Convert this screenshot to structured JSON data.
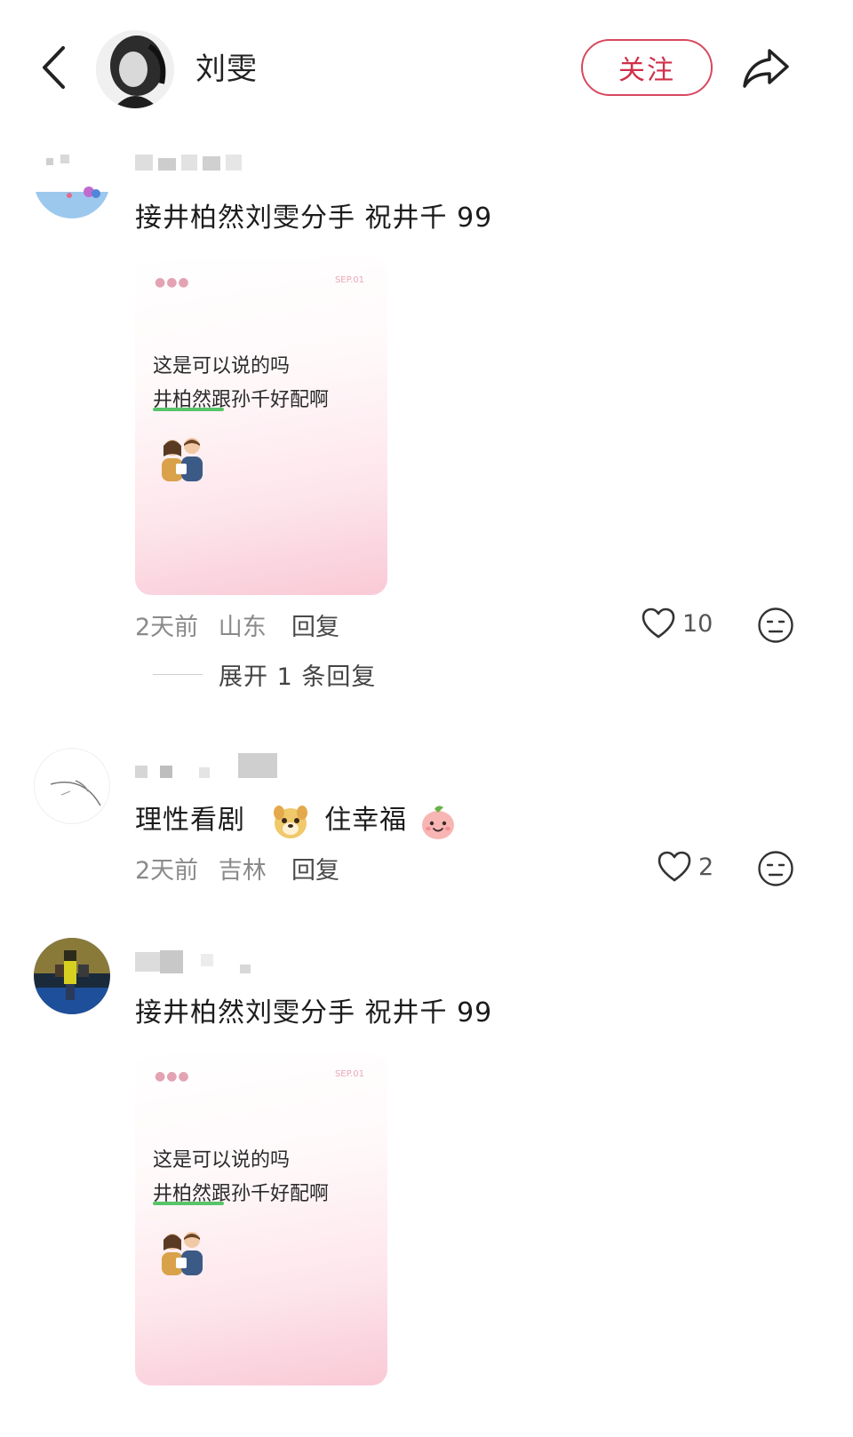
{
  "header": {
    "user_name": "刘雯",
    "follow_label": "关注"
  },
  "comments": [
    {
      "text": "接井柏然刘雯分手 祝井千 99",
      "image": {
        "tag": "SEP.01",
        "line1": "这是可以说的吗",
        "line2": "井柏然跟孙千好配啊"
      },
      "time": "2天前",
      "location": "山东",
      "reply_label": "回复",
      "likes": "10",
      "expand_label": "展开 1 条回复"
    },
    {
      "text_a": "理性看剧",
      "text_b": "住幸福",
      "time": "2天前",
      "location": "吉林",
      "reply_label": "回复",
      "likes": "2"
    },
    {
      "text": "接井柏然刘雯分手 祝井千 99",
      "image": {
        "tag": "SEP.01",
        "line1": "这是可以说的吗",
        "line2": "井柏然跟孙千好配啊"
      }
    }
  ],
  "colors": {
    "accent": "#d8485e",
    "highlight": "#58c46a"
  }
}
